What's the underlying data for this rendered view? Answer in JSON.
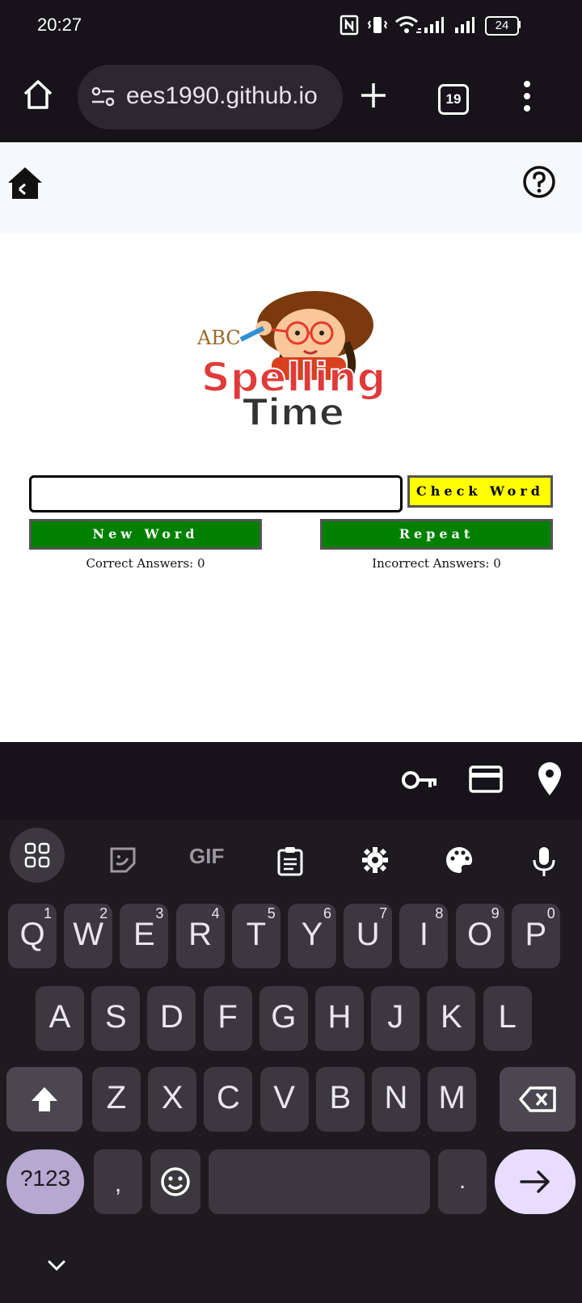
{
  "status_bar": {
    "time": "20:27",
    "battery": "24",
    "icons": [
      "nfc-icon",
      "vibrate-icon",
      "wifi-icon",
      "signal-icon",
      "signal-icon",
      "battery-icon"
    ]
  },
  "browser": {
    "url": "ees1990.github.io",
    "tab_count": "19",
    "icons": [
      "home-icon",
      "site-settings-icon",
      "new-tab-icon",
      "tabs-icon",
      "menu-icon"
    ]
  },
  "page": {
    "logo": {
      "abc_text": "ABC",
      "title_line1": "Spelling",
      "title_line2": "Time"
    },
    "word_input": {
      "value": "",
      "placeholder": ""
    },
    "check_button": "Check Word",
    "new_word_button": "New Word",
    "repeat_button": "Repeat",
    "correct_answers": "Correct Answers: 0",
    "incorrect_answers": "Incorrect Answers: 0",
    "colors": {
      "check": "#ffff00",
      "green": "#008000"
    }
  },
  "autofill": {
    "icons": [
      "key-icon",
      "credit-card-icon",
      "location-pin-icon"
    ]
  },
  "keyboard": {
    "toolbar": {
      "gif_label": "GIF",
      "icons": [
        "apps-grid-icon",
        "sticker-icon",
        "gif-icon",
        "clipboard-icon",
        "settings-icon",
        "palette-icon",
        "mic-icon"
      ]
    },
    "row1": [
      {
        "k": "Q",
        "n": "1"
      },
      {
        "k": "W",
        "n": "2"
      },
      {
        "k": "E",
        "n": "3"
      },
      {
        "k": "R",
        "n": "4"
      },
      {
        "k": "T",
        "n": "5"
      },
      {
        "k": "Y",
        "n": "6"
      },
      {
        "k": "U",
        "n": "7"
      },
      {
        "k": "I",
        "n": "8"
      },
      {
        "k": "O",
        "n": "9"
      },
      {
        "k": "P",
        "n": "0"
      }
    ],
    "row2": [
      "A",
      "S",
      "D",
      "F",
      "G",
      "H",
      "J",
      "K",
      "L"
    ],
    "row3": [
      "Z",
      "X",
      "C",
      "V",
      "B",
      "N",
      "M"
    ],
    "symbols_key": "?123",
    "comma_key": ",",
    "period_key": "."
  }
}
